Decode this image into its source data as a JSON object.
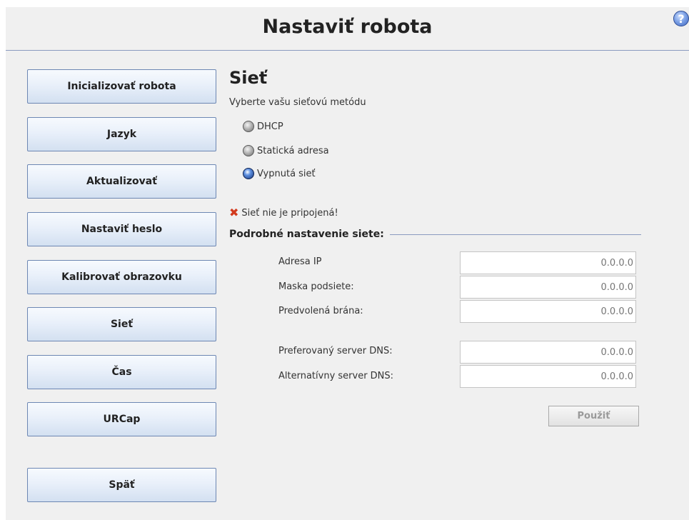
{
  "header": {
    "title": "Nastaviť robota",
    "help_icon": "question-icon"
  },
  "sidebar": {
    "items": [
      {
        "label": "Inicializovať robota"
      },
      {
        "label": "Jazyk"
      },
      {
        "label": "Aktualizovať"
      },
      {
        "label": "Nastaviť heslo"
      },
      {
        "label": "Kalibrovať obrazovku"
      },
      {
        "label": "Sieť"
      },
      {
        "label": "Čas"
      },
      {
        "label": "URCap"
      }
    ],
    "back_label": "Späť"
  },
  "network": {
    "title": "Sieť",
    "subtitle": "Vyberte vašu sieťovú metódu",
    "options": [
      {
        "label": "DHCP",
        "selected": false
      },
      {
        "label": "Statická adresa",
        "selected": false
      },
      {
        "label": "Vypnutá sieť",
        "selected": true
      }
    ],
    "status_text": "Sieť nie je pripojená!",
    "details_title": "Podrobné nastavenie siete:",
    "fields": [
      {
        "label": "Adresa IP",
        "placeholder": "0.0.0.0"
      },
      {
        "label": "Maska podsiete:",
        "placeholder": "0.0.0.0"
      },
      {
        "label": "Predvolená brána:",
        "placeholder": "0.0.0.0"
      },
      {
        "label": "Preferovaný server DNS:",
        "placeholder": "0.0.0.0"
      },
      {
        "label": "Alternatívny server DNS:",
        "placeholder": "0.0.0.0"
      }
    ],
    "apply_label": "Použiť"
  },
  "colors": {
    "accent_border": "#6d87b3",
    "divider": "#8a9bc0",
    "error_icon": "#d23a1e"
  }
}
